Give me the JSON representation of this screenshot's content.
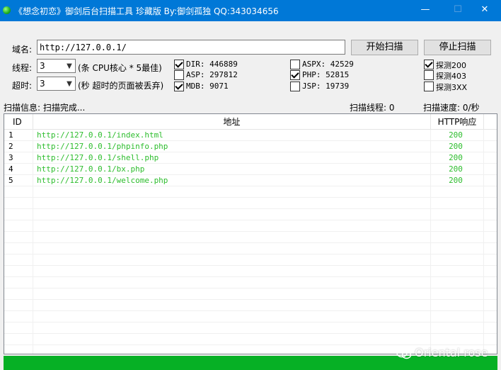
{
  "window": {
    "title": "《想念初恋》御剑后台扫描工具 珍藏版 By:御剑孤独 QQ:343034656",
    "minimize": "—",
    "maximize": "☐",
    "close": "✕"
  },
  "form": {
    "domain_label": "域名:",
    "domain_value": "http://127.0.0.1/",
    "thread_label": "线程:",
    "thread_value": "3",
    "thread_hint": "(条 CPU核心 * 5最佳)",
    "timeout_label": "超时:",
    "timeout_value": "3",
    "timeout_hint": "(秒 超时的页面被丢弃)",
    "start_button": "开始扫描",
    "stop_button": "停止扫描"
  },
  "dictionaries": [
    {
      "label": "DIR: 446889",
      "checked": true
    },
    {
      "label": "ASP: 297812",
      "checked": false
    },
    {
      "label": "MDB: 9071",
      "checked": true
    },
    {
      "label": "ASPX: 42529",
      "checked": false
    },
    {
      "label": "PHP: 52815",
      "checked": true
    },
    {
      "label": "JSP: 19739",
      "checked": false
    }
  ],
  "detect": [
    {
      "label": "探测200",
      "checked": true
    },
    {
      "label": "探测403",
      "checked": false
    },
    {
      "label": "探测3XX",
      "checked": false
    }
  ],
  "status": {
    "info": "扫描信息: 扫描完成...",
    "threads": "扫描线程: 0",
    "speed": "扫描速度: 0/秒"
  },
  "table": {
    "headers": [
      "ID",
      "地址",
      "HTTP响应"
    ],
    "rows": [
      {
        "id": "1",
        "url": "http://127.0.0.1/index.html",
        "code": "200"
      },
      {
        "id": "2",
        "url": "http://127.0.0.1/phpinfo.php",
        "code": "200"
      },
      {
        "id": "3",
        "url": "http://127.0.0.1/shell.php",
        "code": "200"
      },
      {
        "id": "4",
        "url": "http://127.0.0.1/bx.php",
        "code": "200"
      },
      {
        "id": "5",
        "url": "http://127.0.0.1/welcome.php",
        "code": "200"
      }
    ]
  },
  "progress": {
    "value": 1.0,
    "color": "#06b025"
  },
  "watermark": {
    "text": "Oriental rose",
    "icon": "wechat-icon"
  },
  "colors": {
    "titlebar": "#0078d7",
    "result_text": "#2dbd2d"
  }
}
